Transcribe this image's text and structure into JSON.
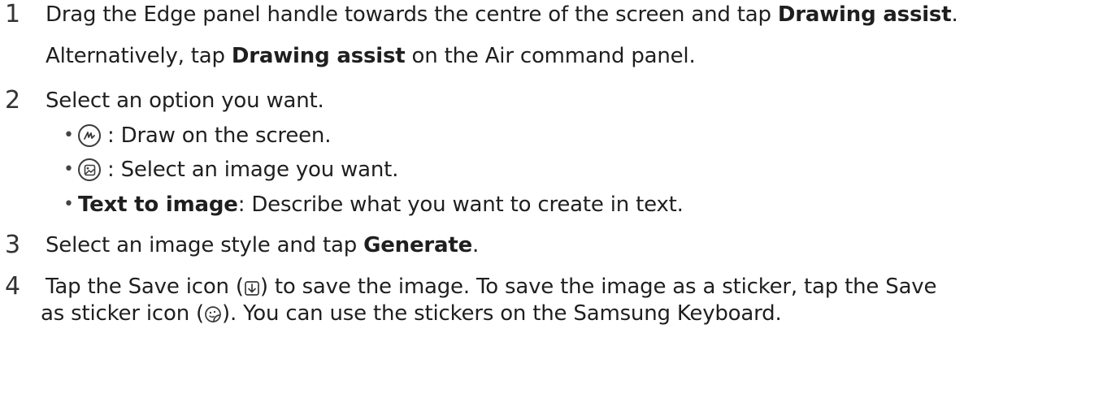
{
  "steps": [
    {
      "number": "1",
      "line1": {
        "a": "Drag the Edge panel handle towards the centre of the screen and tap ",
        "b": "Drawing assist",
        "c": "."
      },
      "line2": {
        "a": "Alternatively, tap ",
        "b": "Drawing assist",
        "c": " on the Air command panel."
      }
    },
    {
      "number": "2",
      "text": "Select an option you want.",
      "options": [
        {
          "icon": "pen-icon",
          "text": ": Draw on the screen."
        },
        {
          "icon": "image-icon",
          "text": ": Select an image you want."
        },
        {
          "bold": "Text to image",
          "text": ": Describe what you want to create in text."
        }
      ]
    },
    {
      "number": "3",
      "a": "Select an image style and tap ",
      "b": "Generate",
      "c": "."
    },
    {
      "number": "4",
      "line1": {
        "a": "Tap the Save icon (",
        "b": ") to save the image. To save the image as a sticker, tap the Save"
      },
      "line2": {
        "a": "as sticker icon (",
        "b": "). You can use the stickers on the Samsung Keyboard."
      }
    }
  ]
}
